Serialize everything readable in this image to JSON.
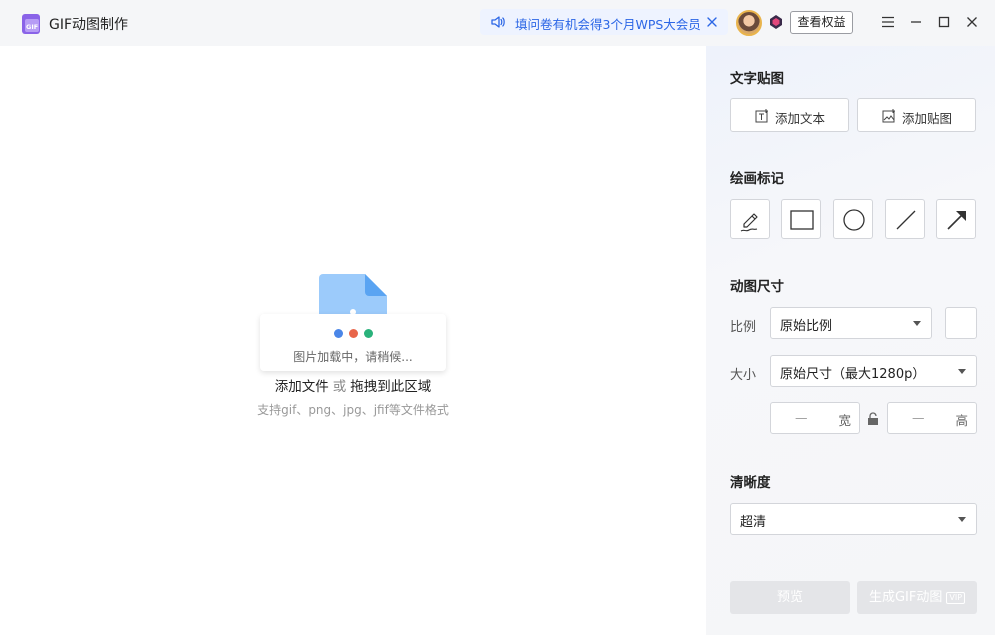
{
  "app": {
    "title": "GIF动图制作",
    "logo_text": "GIF"
  },
  "notice": {
    "text": "填问卷有机会得3个月WPS大会员"
  },
  "header": {
    "rights_label": "查看权益"
  },
  "dropzone": {
    "loading_text": "图片加载中，请稍候...",
    "add_file_label": "添加文件",
    "or_label": "或",
    "drag_label": "拖拽到此区域",
    "support_text": "支持gif、png、jpg、jfif等文件格式"
  },
  "panel": {
    "text_sticker": {
      "title": "文字贴图",
      "add_text_label": "添加文本",
      "add_sticker_label": "添加贴图"
    },
    "drawing": {
      "title": "绘画标记",
      "tools": [
        "pen",
        "rectangle",
        "circle",
        "line",
        "arrow"
      ]
    },
    "size": {
      "title": "动图尺寸",
      "ratio_label": "比例",
      "ratio_value": "原始比例",
      "size_label": "大小",
      "size_value": "原始尺寸（最大1280p）",
      "width_dash": "—",
      "width_unit": "宽",
      "height_dash": "—",
      "height_unit": "高"
    },
    "clarity": {
      "title": "清晰度",
      "value": "超清"
    },
    "actions": {
      "preview_label": "预览",
      "generate_label": "生成GIF动图",
      "vip_tag": "VIP"
    }
  },
  "colors": {
    "accent": "#2b66e6",
    "dot_blue": "#4a86e8",
    "dot_red": "#e8664a",
    "dot_green": "#2ab27b",
    "file_icon": "#8fc4fb"
  }
}
